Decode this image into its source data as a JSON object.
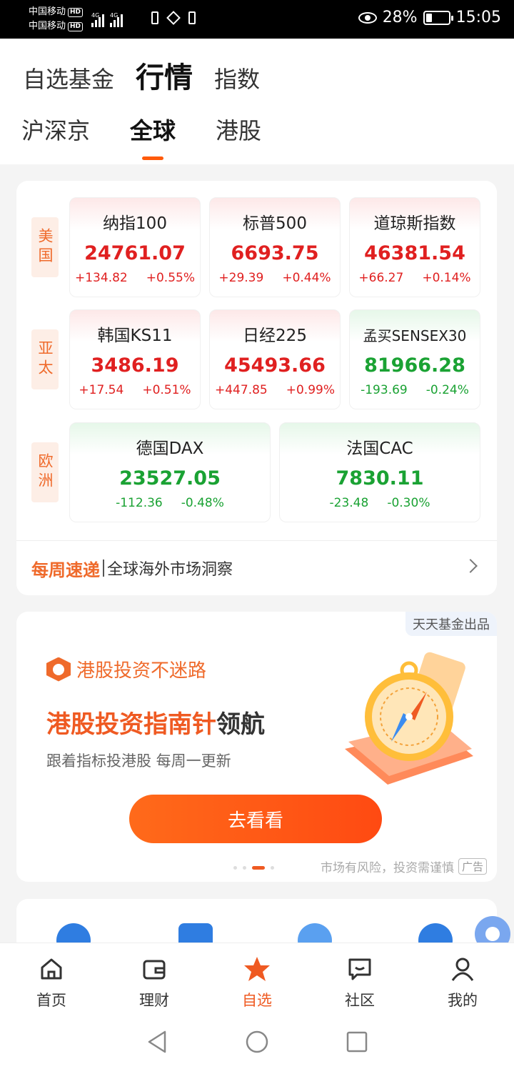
{
  "status_bar": {
    "carrier1": "中国移动",
    "carrier2": "中国移动",
    "hd": "HD",
    "net1": "4G",
    "net2": "4G",
    "battery": "28%",
    "battery_level": 0.28,
    "time": "15:05"
  },
  "header": {
    "main_tabs": [
      {
        "label": "自选基金",
        "active": false
      },
      {
        "label": "行情",
        "active": true
      },
      {
        "label": "指数",
        "active": false
      }
    ],
    "sub_tabs": [
      {
        "label": "沪深京",
        "active": false
      },
      {
        "label": "全球",
        "active": true
      },
      {
        "label": "港股",
        "active": false
      }
    ]
  },
  "markets": {
    "regions": [
      {
        "label": "美国",
        "indices": [
          {
            "name": "纳指100",
            "value": "24761.07",
            "change": "+134.82",
            "pct": "+0.55%",
            "trend": "up"
          },
          {
            "name": "标普500",
            "value": "6693.75",
            "change": "+29.39",
            "pct": "+0.44%",
            "trend": "up"
          },
          {
            "name": "道琼斯指数",
            "value": "46381.54",
            "change": "+66.27",
            "pct": "+0.14%",
            "trend": "up"
          }
        ]
      },
      {
        "label": "亚太",
        "indices": [
          {
            "name": "韩国KS11",
            "value": "3486.19",
            "change": "+17.54",
            "pct": "+0.51%",
            "trend": "up"
          },
          {
            "name": "日经225",
            "value": "45493.66",
            "change": "+447.85",
            "pct": "+0.99%",
            "trend": "up"
          },
          {
            "name": "孟买SENSEX30",
            "value": "81966.28",
            "change": "-193.69",
            "pct": "-0.24%",
            "trend": "down"
          }
        ]
      },
      {
        "label": "欧洲",
        "indices": [
          {
            "name": "德国DAX",
            "value": "23527.05",
            "change": "-112.36",
            "pct": "-0.48%",
            "trend": "down"
          },
          {
            "name": "法国CAC",
            "value": "7830.11",
            "change": "-23.48",
            "pct": "-0.30%",
            "trend": "down"
          }
        ]
      }
    ],
    "weekly": {
      "tag": "每周速递",
      "text": "全球海外市场洞察"
    }
  },
  "ad": {
    "source": "天天基金出品",
    "brand": "港股投资不迷路",
    "headline_highlight": "港股投资指南针",
    "headline_rest": "领航",
    "subtitle": "跟着指标投港股 每周一更新",
    "button": "去看看",
    "risk_text": "市场有风险，投资需谨慎",
    "ad_label": "广告",
    "page_count": 4,
    "page_active": 2
  },
  "bottom_nav": [
    {
      "label": "首页",
      "icon": "home-icon",
      "active": false
    },
    {
      "label": "理财",
      "icon": "wallet-icon",
      "active": false
    },
    {
      "label": "自选",
      "icon": "star-icon",
      "active": true
    },
    {
      "label": "社区",
      "icon": "chat-icon",
      "active": false
    },
    {
      "label": "我的",
      "icon": "person-icon",
      "active": false
    }
  ],
  "colors": {
    "accent": "#ef5a22",
    "up": "#e02020",
    "down": "#1aa233",
    "region_bg": "#fdeee6"
  }
}
